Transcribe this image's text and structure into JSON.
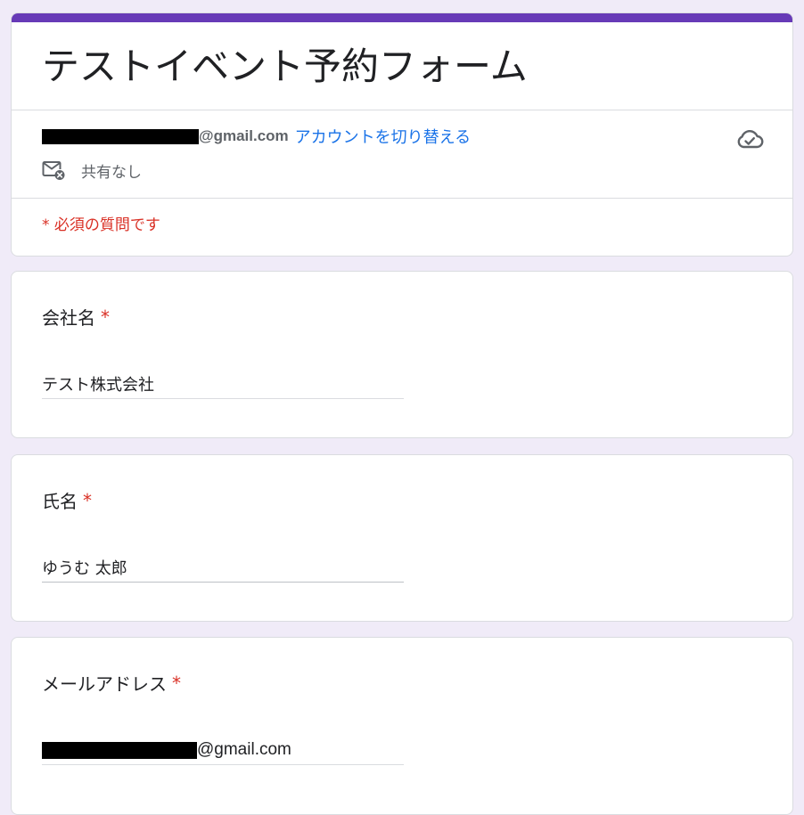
{
  "form": {
    "title": "テストイベント予約フォーム",
    "accent_color": "#673ab7",
    "background_color": "#f0ebf8",
    "required_color": "#d93025",
    "link_color": "#1a73e8"
  },
  "account": {
    "email_domain": "@gmail.com",
    "switch_label": "アカウントを切り替える",
    "share_status": "共有なし",
    "save_status_icon": "cloud-done-icon",
    "share_icon": "mail-off-icon"
  },
  "required_note": "* 必須の質問です",
  "questions": [
    {
      "label": "会社名",
      "required_mark": "*",
      "value": "テスト株式会社"
    },
    {
      "label": "氏名",
      "required_mark": "*",
      "value": "ゆうむ 太郎"
    },
    {
      "label": "メールアドレス",
      "required_mark": "*",
      "value_suffix": "@gmail.com"
    }
  ]
}
